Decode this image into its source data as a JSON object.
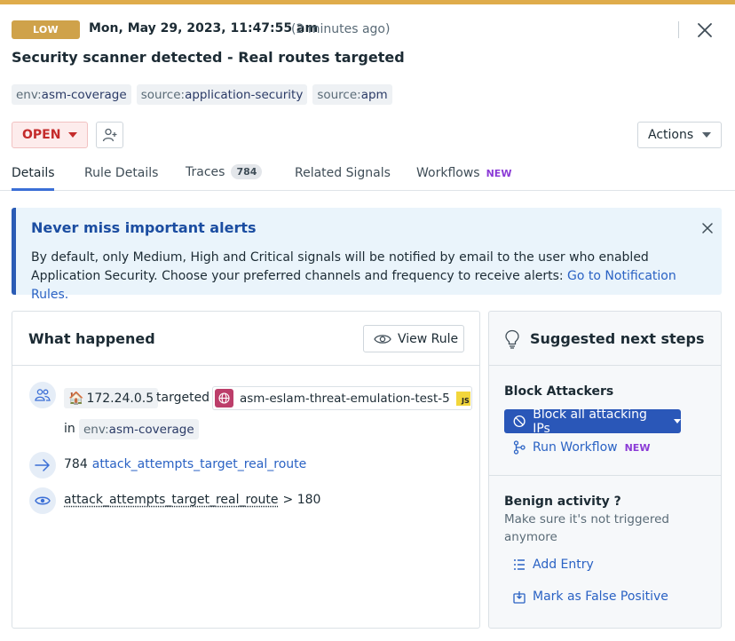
{
  "header": {
    "severity": "LOW",
    "timestamp": "Mon, May 29, 2023, 11:47:55 am",
    "relative_time": "(2 minutes ago)",
    "title": "Security scanner detected - Real routes targeted"
  },
  "tags": [
    {
      "key": "env:",
      "value": "asm-coverage"
    },
    {
      "key": "source:",
      "value": "application-security"
    },
    {
      "key": "source:",
      "value": "apm"
    }
  ],
  "status": {
    "label": "OPEN"
  },
  "actions_label": "Actions",
  "tabs": [
    {
      "label": "Details"
    },
    {
      "label": "Rule Details"
    },
    {
      "label": "Traces",
      "count": "784"
    },
    {
      "label": "Related Signals"
    },
    {
      "label": "Workflows",
      "badge": "NEW"
    }
  ],
  "alert": {
    "title": "Never miss important alerts",
    "body": "By default, only Medium, High and Critical signals will be notified by email to the user who enabled Application Security. Choose your preferred channels and frequency to receive alerts: ",
    "link": "Go to Notification Rules."
  },
  "what_happened": {
    "title": "What happened",
    "view_rule": "View Rule",
    "ip": "172.24.0.5",
    "targeted": "targeted",
    "service": "asm-eslam-threat-emulation-test-5",
    "service_lang": "JS",
    "in_label": "in",
    "env_tag": {
      "key": "env:",
      "value": "asm-coverage"
    },
    "attempts_count": "784",
    "attempts_rule": "attack_attempts_target_real_route",
    "condition_rule": "attack_attempts_target_real_route",
    "condition": "> 180"
  },
  "suggested": {
    "title": "Suggested next steps",
    "block_title": "Block Attackers",
    "block_button": "Block all attacking IPs",
    "run_workflow": "Run Workflow",
    "run_workflow_badge": "NEW",
    "benign_title": "Benign activity ?",
    "benign_sub": "Make sure it's not triggered anymore",
    "add_entry": "Add Entry",
    "mark_false_positive": "Mark as False Positive"
  }
}
